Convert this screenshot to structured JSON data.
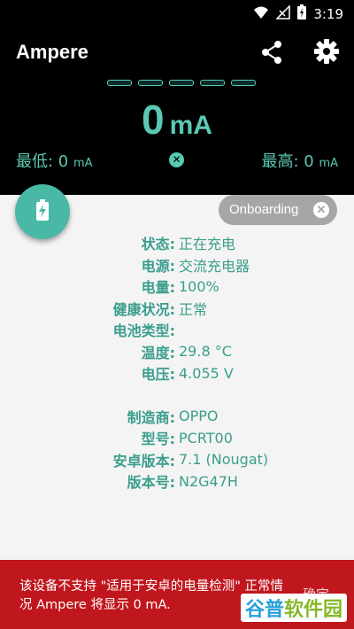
{
  "statusbar": {
    "time": "3:19"
  },
  "appbar": {
    "title": "Ampere"
  },
  "meter": {
    "value": "0",
    "unit": "mA",
    "min_label": "最低: ",
    "min_value": "0",
    "max_label": "最高: ",
    "max_value": "0",
    "small_unit": "mA"
  },
  "onboarding": {
    "label": "Onboarding"
  },
  "info": {
    "rows1": [
      {
        "k": "状态:",
        "v": "正在充电"
      },
      {
        "k": "电源:",
        "v": "交流充电器"
      },
      {
        "k": "电量:",
        "v": "100%"
      },
      {
        "k": "健康状况:",
        "v": "正常"
      },
      {
        "k": "电池类型:",
        "v": ""
      },
      {
        "k": "温度:",
        "v": "29.8 °C"
      },
      {
        "k": "电压:",
        "v": "4.055 V"
      }
    ],
    "rows2": [
      {
        "k": "制造商:",
        "v": "OPPO"
      },
      {
        "k": "型号:",
        "v": "PCRT00"
      },
      {
        "k": "安卓版本:",
        "v": "7.1 (Nougat)"
      },
      {
        "k": "版本号:",
        "v": "N2G47H"
      }
    ]
  },
  "banner": {
    "message": "该设备不支持 \"适用于安卓的电量检测\" 正常情况 Ampere 将显示 0 mA.",
    "action": "确定"
  },
  "watermark": {
    "part1": "谷普",
    "part2": "软件园"
  },
  "colors": {
    "accent": "#59c9b4",
    "banner": "#c0161d"
  }
}
